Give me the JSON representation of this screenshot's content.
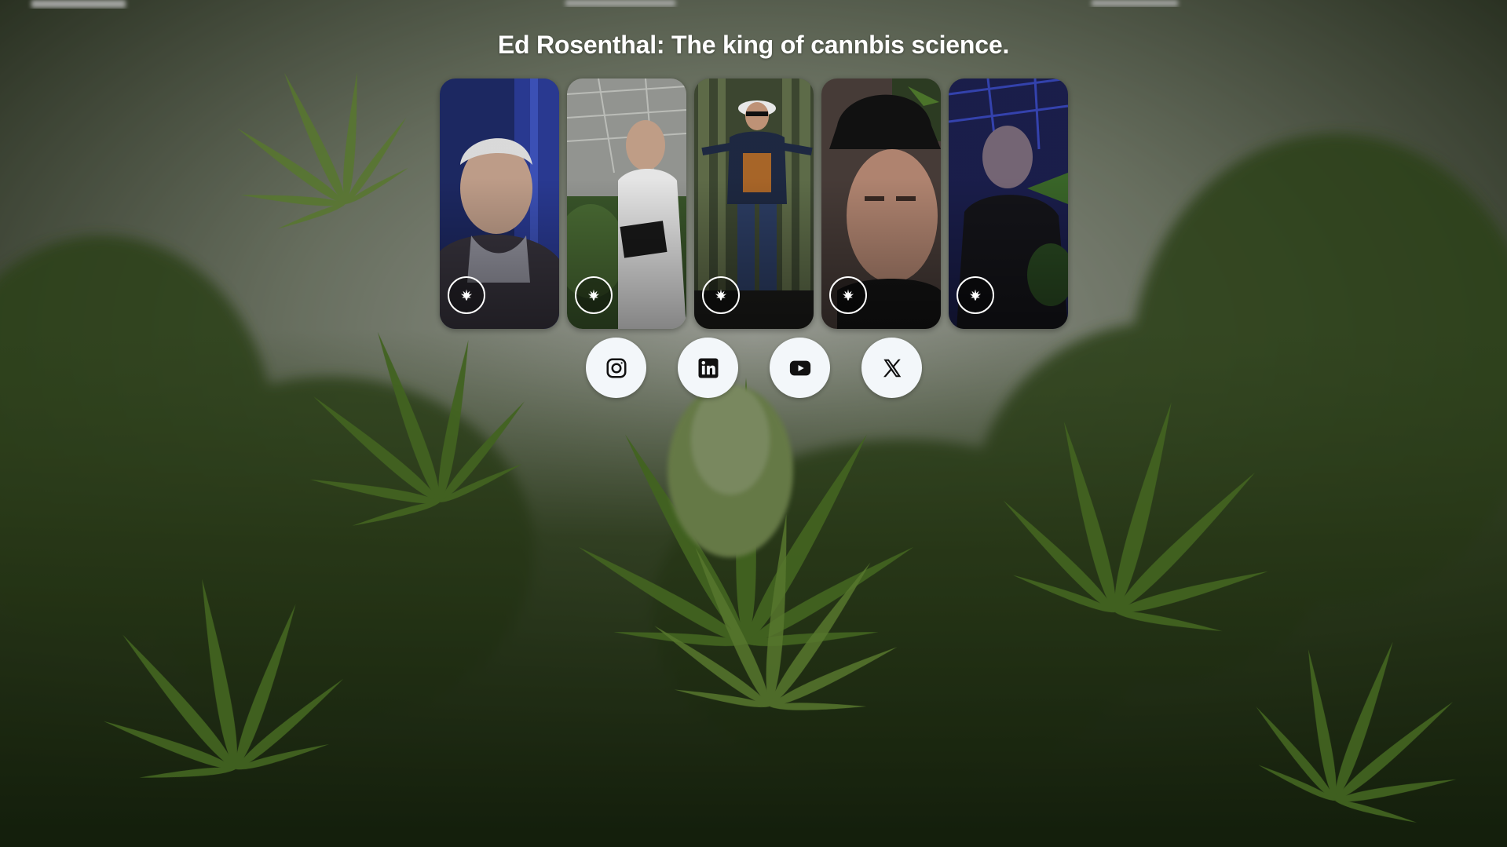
{
  "header": {
    "title": "Ed Rosenthal: The king of cannbis science."
  },
  "gallery": {
    "cards": [
      {
        "subject": "portrait-blue-wall",
        "badge_icon": "cannabis-leaf-icon"
      },
      {
        "subject": "portrait-greenhouse-lab-coat",
        "badge_icon": "cannabis-leaf-icon"
      },
      {
        "subject": "portrait-grow-field-sunglasses",
        "badge_icon": "cannabis-leaf-icon"
      },
      {
        "subject": "portrait-black-hat-closeup",
        "badge_icon": "cannabis-leaf-icon"
      },
      {
        "subject": "portrait-blue-light-grow-room",
        "badge_icon": "cannabis-leaf-icon"
      }
    ]
  },
  "social": [
    {
      "icon": "instagram-icon"
    },
    {
      "icon": "linkedin-icon"
    },
    {
      "icon": "youtube-icon"
    },
    {
      "icon": "x-icon"
    }
  ],
  "colors": {
    "title_text": "#ffffff",
    "social_button_bg": "#f3f7fa",
    "social_icon": "#111111",
    "background_foliage": "#3f5a25",
    "background_light": "#c8cec0"
  }
}
